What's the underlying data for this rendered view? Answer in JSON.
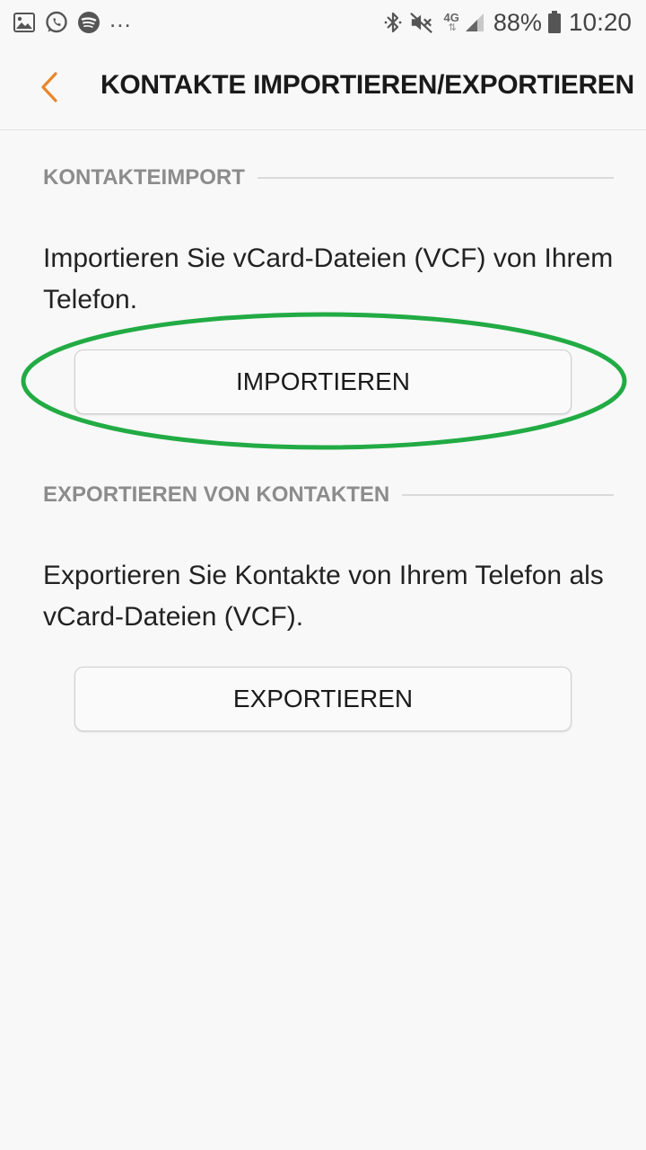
{
  "status_bar": {
    "left_icons": [
      "gallery-icon",
      "whatsapp-icon",
      "spotify-icon"
    ],
    "overflow": "...",
    "network": "4G",
    "battery": "88%",
    "time": "10:20"
  },
  "app_bar": {
    "title": "KONTAKTE IMPORTIEREN/EXPORTIEREN",
    "accent_color": "#e8862a"
  },
  "import_section": {
    "header": "KONTAKTEIMPORT",
    "description": "Importieren Sie vCard-Dateien (VCF) von Ihrem Telefon.",
    "button_label": "IMPORTIEREN"
  },
  "export_section": {
    "header": "EXPORTIEREN VON KONTAKTEN",
    "description": "Exportieren Sie Kontakte von Ihrem Telefon als vCard-Dateien (VCF).",
    "button_label": "EXPORTIEREN"
  },
  "annotation": {
    "highlight_color": "#22ab44"
  }
}
